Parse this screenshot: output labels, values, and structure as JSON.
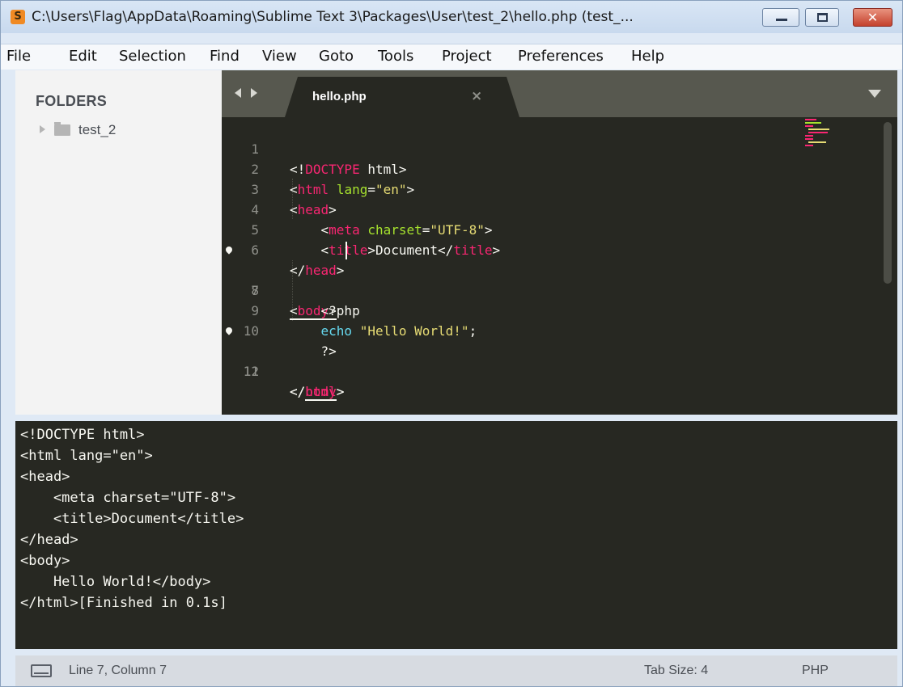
{
  "window": {
    "title": "C:\\Users\\Flag\\AppData\\Roaming\\Sublime Text 3\\Packages\\User\\test_2\\hello.php (test_..."
  },
  "menu": [
    "File",
    "Edit",
    "Selection",
    "Find",
    "View",
    "Goto",
    "Tools",
    "Project",
    "Preferences",
    "Help"
  ],
  "sidebar": {
    "header": "FOLDERS",
    "folder": "test_2"
  },
  "editor": {
    "tab": "hello.php",
    "close_glyph": "×",
    "line_numbers": [
      "1",
      "2",
      "3",
      "4",
      "5",
      "6",
      "7",
      "8",
      "9",
      "10",
      "11",
      "12"
    ],
    "code_lines": [
      "<!DOCTYPE html>",
      "<html lang=\"en\">",
      "<head>",
      "    <meta charset=\"UTF-8\">",
      "    <title>Document</title>",
      "</head>",
      "<body>",
      "    <?php",
      "    echo \"Hello World!\";",
      "    ?>",
      "</body>",
      "</html>"
    ],
    "current_line": 7
  },
  "output": {
    "lines": [
      "<!DOCTYPE html>",
      "<html lang=\"en\">",
      "<head>",
      "    <meta charset=\"UTF-8\">",
      "    <title>Document</title>",
      "</head>",
      "<body>",
      "    Hello World!</body>",
      "</html>[Finished in 0.1s]"
    ]
  },
  "status": {
    "position": "Line 7, Column 7",
    "tab_size": "Tab Size: 4",
    "syntax": "PHP"
  },
  "colors": {
    "editor_bg": "#272822",
    "tag": "#f92672",
    "attribute": "#a6e22e",
    "string": "#e6db74",
    "keyword": "#66d9ef",
    "text": "#f8f8f2",
    "line_number": "#8f908a",
    "icon_accent": "#f08a24"
  }
}
